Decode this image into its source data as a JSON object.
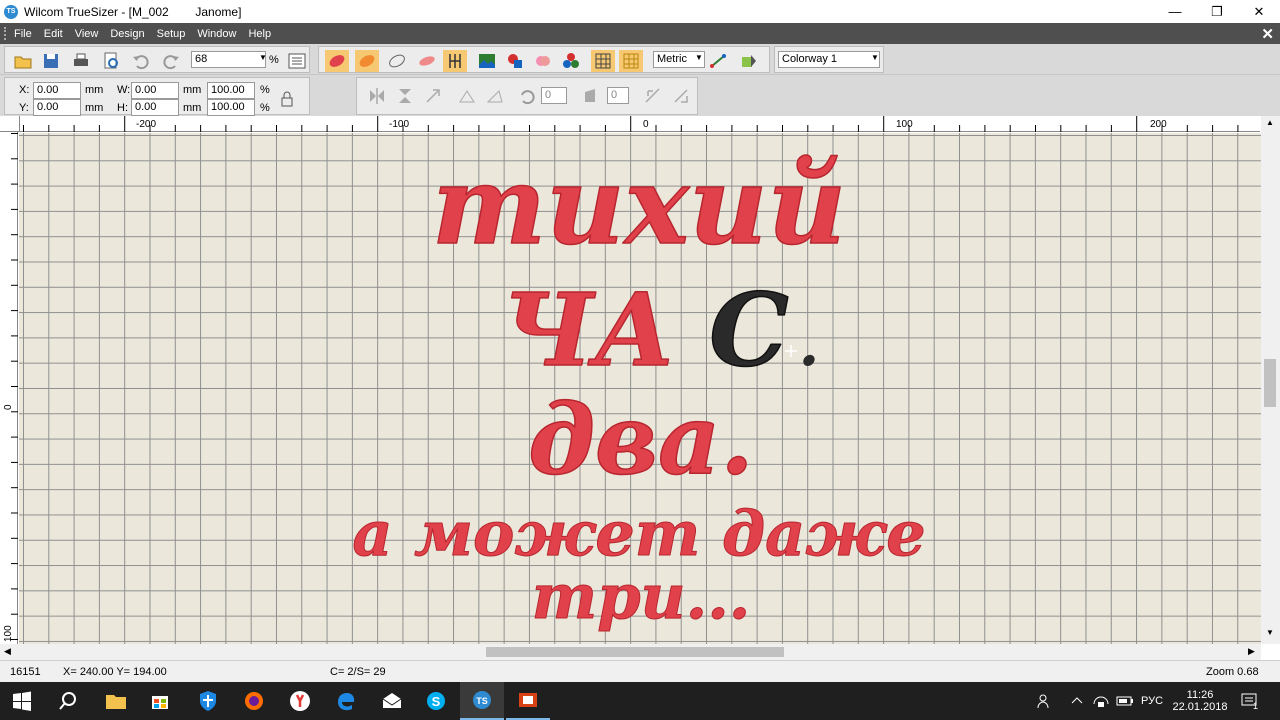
{
  "window": {
    "title": "Wilcom TrueSizer - [M_002        Janome]",
    "app_icon_text": "TS",
    "minimize": "—",
    "maximize": "❐",
    "close": "✕"
  },
  "menu": {
    "items": [
      "File",
      "Edit",
      "View",
      "Design",
      "Setup",
      "Window",
      "Help"
    ],
    "mdi_close": "✕"
  },
  "toolbar": {
    "zoom_value": "68",
    "zoom_unit": "%",
    "units_value": "Metric",
    "colorway_value": "Colorway 1"
  },
  "transform": {
    "x_label": "X:",
    "x_value": "0.00",
    "x_unit": "mm",
    "y_label": "Y:",
    "y_value": "0.00",
    "y_unit": "mm",
    "w_label": "W:",
    "w_value": "0.00",
    "w_unit": "mm",
    "h_label": "H:",
    "h_value": "0.00",
    "h_unit": "mm",
    "w_pct": "100.00",
    "h_pct": "100.00",
    "pct_unit": "%",
    "rotate_value": "0",
    "slant_value": "0"
  },
  "rulers": {
    "h_ticks": [
      "-200",
      "-100",
      "0",
      "100",
      "200"
    ],
    "v_ticks": [
      "0",
      "100"
    ]
  },
  "design": {
    "line1": "тихий",
    "line2_red": "ЧА",
    "line2_black": "С",
    "line2_dot": ".",
    "line3": "два.",
    "line4": "а может даже",
    "line5": "три...",
    "thread_red": "#e0414a",
    "thread_dark": "#2a2a2a"
  },
  "status": {
    "stitches": "16151",
    "coords": "X= 240.00 Y= 194.00",
    "color_stop": "C= 2/S= 29",
    "zoom": "Zoom 0.68"
  },
  "taskbar": {
    "tray_lang": "РУС",
    "time": "11:26",
    "date": "22.01.2018",
    "notif_count": "1"
  }
}
